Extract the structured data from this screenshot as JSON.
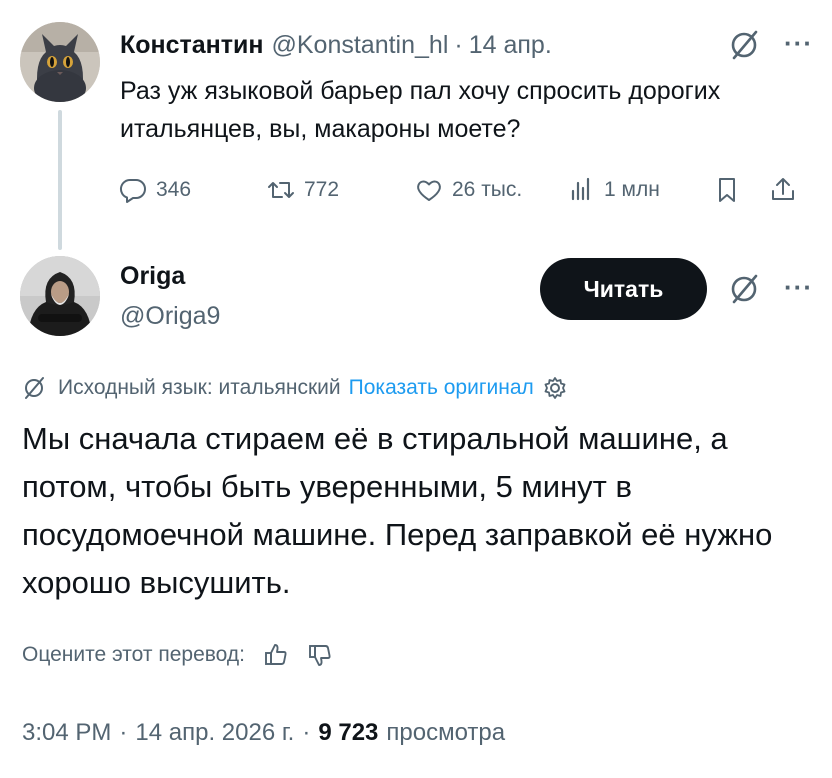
{
  "original_tweet": {
    "author_name": "Константин",
    "author_handle": "@Konstantin_hl",
    "separator": "·",
    "date": "14 апр.",
    "text": "Раз уж языковой барьер пал хочу спросить дорогих итальянцев, вы, макароны моете?",
    "replies_count": "346",
    "retweets_count": "772",
    "likes_count": "26 тыс.",
    "views_count": "1 млн",
    "more_label": "···"
  },
  "reply_tweet": {
    "author_name": "Origa",
    "author_handle": "@Origa9",
    "follow_label": "Читать",
    "more_label": "···",
    "translation_source_label": "Исходный язык: итальянский",
    "show_original_label": "Показать оригинал",
    "text": "Мы сначала стираем её в стиральной машине, а потом, чтобы быть уверенными, 5 минут в посудомоечной машине. Перед заправкой её нужно хорошо высушить.",
    "rate_translation_label": "Оцените этот перевод:",
    "time": "3:04 PM",
    "date": "14 апр. 2026 г.",
    "separator": "·",
    "views_number": "9 723",
    "views_label": "просмотра"
  },
  "colors": {
    "text": "#0f1419",
    "muted": "#536471",
    "link": "#1d9bf0",
    "follow_bg": "#0f1419",
    "thread_line": "#cfd9de"
  }
}
